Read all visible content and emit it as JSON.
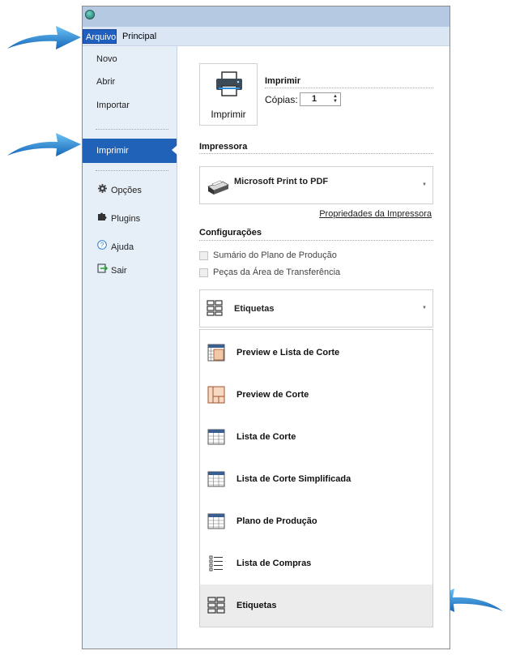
{
  "ribbon": {
    "tabs": [
      {
        "label": "Arquivo",
        "active": true
      },
      {
        "label": "Principal",
        "active": false
      }
    ]
  },
  "sidebar": {
    "items": [
      {
        "label": "Novo"
      },
      {
        "label": "Abrir"
      },
      {
        "label": "Importar"
      },
      {
        "label": "Imprimir",
        "selected": true
      },
      {
        "label": "Opções",
        "icon": "gear-icon"
      },
      {
        "label": "Plugins",
        "icon": "puzzle-icon"
      },
      {
        "label": "Ajuda",
        "icon": "help-icon"
      },
      {
        "label": "Sair",
        "icon": "exit-icon"
      }
    ]
  },
  "print": {
    "tile_label": "Imprimir",
    "section_title": "Imprimir",
    "copies_label": "Cópias:",
    "copies_value": "1"
  },
  "printer": {
    "section_title": "Impressora",
    "name": "Microsoft Print to PDF",
    "properties_link": "Propriedades da Impressora"
  },
  "settings": {
    "section_title": "Configurações",
    "checkboxes": [
      {
        "label": "Sumário do Plano de Produção",
        "checked": false
      },
      {
        "label": "Peças da Área de Transferência",
        "checked": false
      }
    ],
    "selected_report": "Etiquetas",
    "reports": [
      {
        "label": "Preview e Lista de Corte",
        "icon": "preview-list-icon"
      },
      {
        "label": "Preview de Corte",
        "icon": "preview-icon"
      },
      {
        "label": "Lista de Corte",
        "icon": "table-icon"
      },
      {
        "label": "Lista de Corte Simplificada",
        "icon": "table-icon"
      },
      {
        "label": "Plano de Produção",
        "icon": "table-icon"
      },
      {
        "label": "Lista de Compras",
        "icon": "list-icon"
      },
      {
        "label": "Etiquetas",
        "icon": "labels-icon",
        "highlighted": true
      }
    ]
  },
  "colors": {
    "accent": "#1f62b8",
    "ribbon_bg": "#dbe6f4",
    "sidebar_bg": "#e6eef8",
    "arrow": "#2f8fd8"
  }
}
